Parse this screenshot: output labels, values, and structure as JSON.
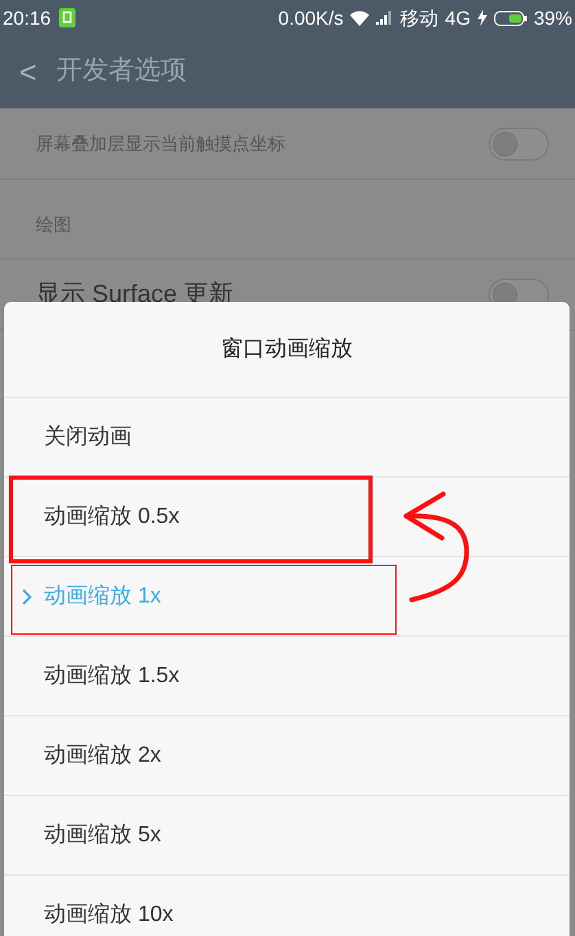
{
  "status_bar": {
    "time": "20:16",
    "speed": "0.00K/s",
    "carrier": "移动",
    "network": "4G",
    "battery": "39%"
  },
  "header": {
    "back": "<",
    "title": "开发者选项"
  },
  "settings": [
    {
      "kind": "toggle",
      "subtitle": "屏幕叠加层显示当前触摸点坐标",
      "on": false
    },
    {
      "kind": "section",
      "title": "绘图"
    },
    {
      "kind": "toggle",
      "title": "显示 Surface 更新",
      "on": false
    }
  ],
  "dialog": {
    "title": "窗口动画缩放",
    "options": [
      {
        "label": "关闭动画",
        "selected": false
      },
      {
        "label": "动画缩放 0.5x",
        "selected": false
      },
      {
        "label": "动画缩放 1x",
        "selected": true
      },
      {
        "label": "动画缩放 1.5x",
        "selected": false
      },
      {
        "label": "动画缩放 2x",
        "selected": false
      },
      {
        "label": "动画缩放 5x",
        "selected": false
      },
      {
        "label": "动画缩放 10x",
        "selected": false
      }
    ]
  }
}
